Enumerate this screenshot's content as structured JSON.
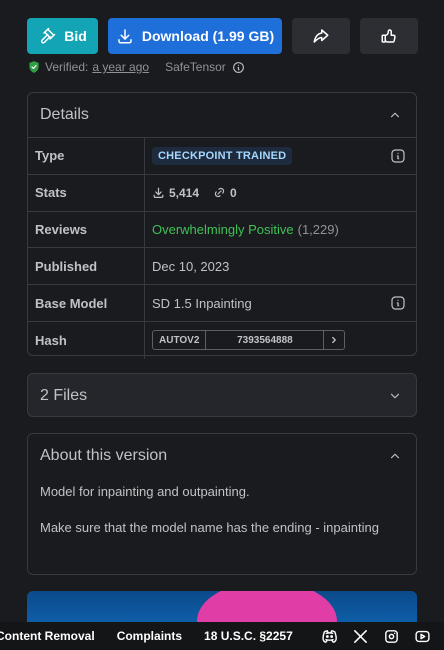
{
  "actions": {
    "bid_label": "Bid",
    "download_label": "Download (1.99 GB)"
  },
  "verified": {
    "prefix": "Verified:",
    "age": "a year ago",
    "format": "SafeTensor"
  },
  "details": {
    "title": "Details",
    "rows": {
      "type": {
        "label": "Type",
        "badge": "CHECKPOINT TRAINED"
      },
      "stats": {
        "label": "Stats",
        "downloads": "5,414",
        "links": "0"
      },
      "reviews": {
        "label": "Reviews",
        "sentiment": "Overwhelmingly Positive",
        "count": "(1,229)"
      },
      "published": {
        "label": "Published",
        "value": "Dec 10, 2023"
      },
      "base_model": {
        "label": "Base Model",
        "value": "SD 1.5 Inpainting"
      },
      "hash": {
        "label": "Hash",
        "type": "AUTOV2",
        "value": "7393564888"
      }
    }
  },
  "files": {
    "title": "2 Files"
  },
  "about": {
    "title": "About this version",
    "p1": "Model for inpainting and outpainting.",
    "p2": "Make sure that the model name has the ending - inpainting"
  },
  "footer": {
    "links": [
      "Content Removal",
      "Complaints",
      "18 U.S.C. §2257"
    ],
    "socials": [
      "discord-icon",
      "x-icon",
      "instagram-icon",
      "youtube-icon"
    ]
  },
  "colors": {
    "bid": "#13a5b6",
    "download": "#1e6fd9",
    "positive": "#40c057",
    "badge_text": "#a5d8ff"
  }
}
